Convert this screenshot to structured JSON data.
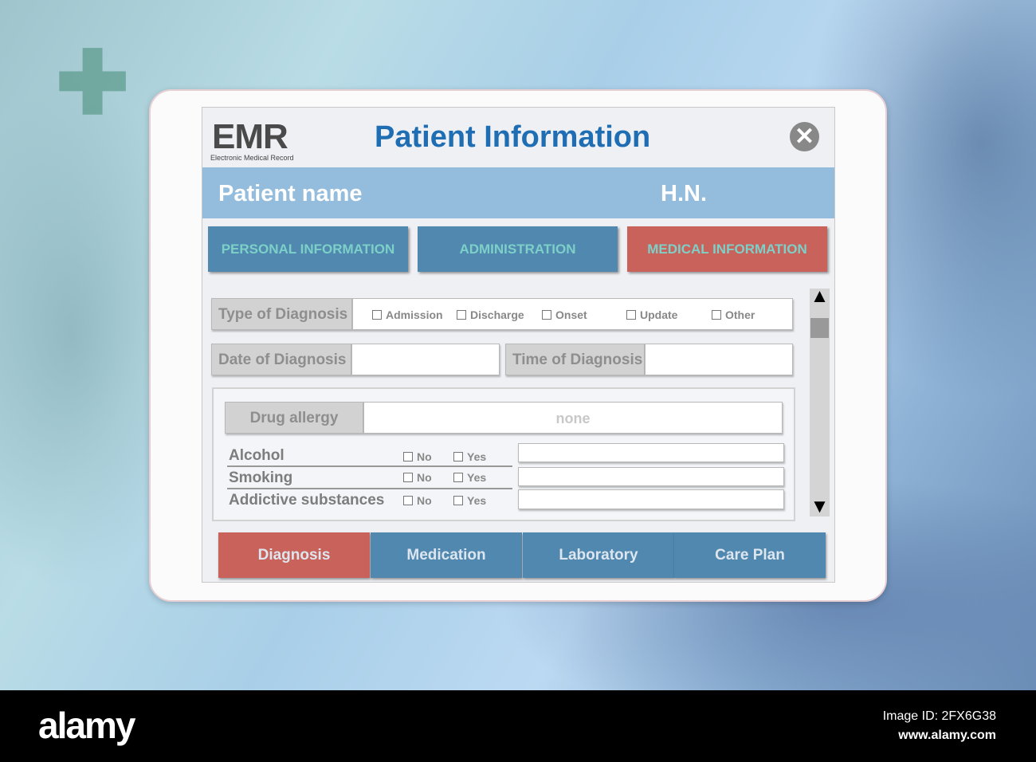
{
  "app": {
    "logo": "EMR",
    "logo_subtitle": "Electronic Medical Record",
    "title": "Patient Information"
  },
  "patient": {
    "name_label": "Patient name",
    "hn_label": "H.N."
  },
  "tabs": [
    {
      "label": "PERSONAL INFORMATION"
    },
    {
      "label": "ADMINISTRATION"
    },
    {
      "label": "MEDICAL INFORMATION",
      "active": true
    }
  ],
  "form": {
    "type_label": "Type of Diagnosis",
    "type_options": [
      "Admission",
      "Discharge",
      "Onset",
      "Update",
      "Other"
    ],
    "date_label": "Date of Diagnosis",
    "date_value": "",
    "time_label": "Time of Diagnosis",
    "time_value": "",
    "drug_allergy_label": "Drug allergy",
    "drug_allergy_value": "none",
    "habits": [
      {
        "label": "Alcohol",
        "no": "No",
        "yes": "Yes"
      },
      {
        "label": "Smoking",
        "no": "No",
        "yes": "Yes"
      },
      {
        "label": "Addictive substances",
        "no": "No",
        "yes": "Yes"
      }
    ]
  },
  "bottom_tabs": [
    {
      "label": "Diagnosis",
      "active": true
    },
    {
      "label": "Medication"
    },
    {
      "label": "Laboratory"
    },
    {
      "label": "Care Plan"
    }
  ],
  "scroll": {
    "up": "▲",
    "down": "▼",
    "position": 0.05
  },
  "footer": {
    "brand": "alamy",
    "image_id": "Image ID: 2FX6G38",
    "url": "www.alamy.com"
  },
  "colors": {
    "title": "#1f6eb3",
    "band": "#94bcdc",
    "tab_blue": "#5088b0",
    "tab_red": "#c8625a"
  }
}
